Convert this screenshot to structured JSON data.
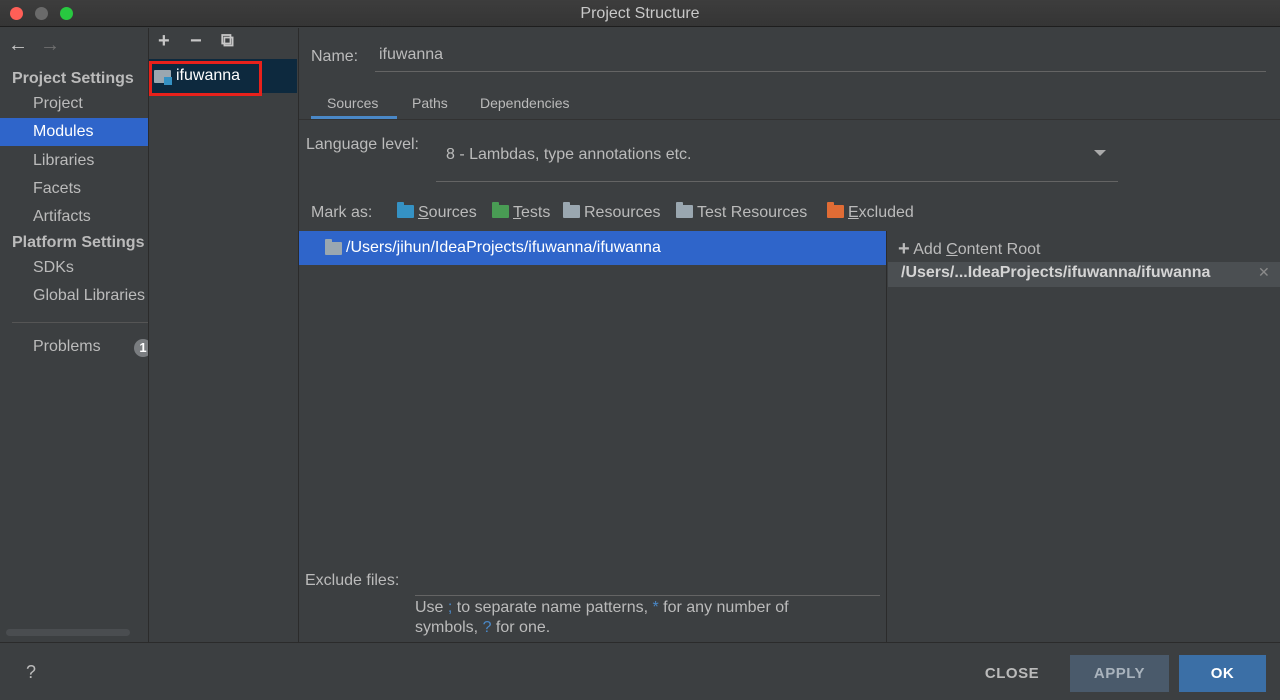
{
  "window": {
    "title": "Project Structure"
  },
  "nav": {
    "back_icon": "←",
    "forward_icon": "→"
  },
  "sidebar": {
    "project_settings_header": "Project Settings",
    "platform_settings_header": "Platform Settings",
    "items": [
      {
        "label": "Project"
      },
      {
        "label": "Modules"
      },
      {
        "label": "Libraries"
      },
      {
        "label": "Facets"
      },
      {
        "label": "Artifacts"
      },
      {
        "label": "SDKs"
      },
      {
        "label": "Global Libraries"
      },
      {
        "label": "Problems"
      }
    ],
    "selected": "Modules",
    "problems_count": "1"
  },
  "module_tree": {
    "toolbar": {
      "add": "+",
      "remove": "−",
      "copy": "⧉"
    },
    "module_name": "ifuwanna"
  },
  "module": {
    "name_label": "Name:",
    "name_value": "ifuwanna",
    "tabs": [
      {
        "label": "Sources"
      },
      {
        "label": "Paths"
      },
      {
        "label": "Dependencies"
      }
    ],
    "active_tab": "Sources",
    "language_level_label": "Language level:",
    "language_level_value": "8 - Lambdas, type annotations etc.",
    "mark_as_label": "Mark as:",
    "mark_as": [
      {
        "label": "Sources",
        "underline": "S",
        "rest": "ources",
        "color": "#3592c4"
      },
      {
        "label": "Tests",
        "underline": "T",
        "rest": "ests",
        "color": "#499c54"
      },
      {
        "label": "Resources",
        "underline": "",
        "rest": "Resources",
        "color": "#9aa7b0"
      },
      {
        "label": "Test Resources",
        "underline": "",
        "rest": "Test Resources",
        "color": "#9aa7b0"
      },
      {
        "label": "Excluded",
        "underline": "E",
        "rest": "xcluded",
        "color": "#e06c35"
      }
    ],
    "content_root_path": "/Users/jihun/IdeaProjects/ifuwanna/ifuwanna",
    "add_content_root": {
      "prefix": "Add ",
      "underline": "C",
      "rest": "ontent Root"
    },
    "content_root_short": "/Users/...IdeaProjects/ifuwanna/ifuwanna",
    "exclude_files_label": "Exclude files:",
    "hint": {
      "part1": "Use ",
      "sym1": ";",
      "part2": " to separate name patterns, ",
      "sym2": "*",
      "part3": " for any number of symbols, ",
      "sym3": "?",
      "part4": " for one."
    }
  },
  "footer": {
    "help": "?",
    "close": "CLOSE",
    "apply": "APPLY",
    "ok": "OK"
  },
  "colors": {
    "selection": "#2f65ca",
    "highlight_box": "#e8211b",
    "ok_button": "#3b6fa6"
  }
}
